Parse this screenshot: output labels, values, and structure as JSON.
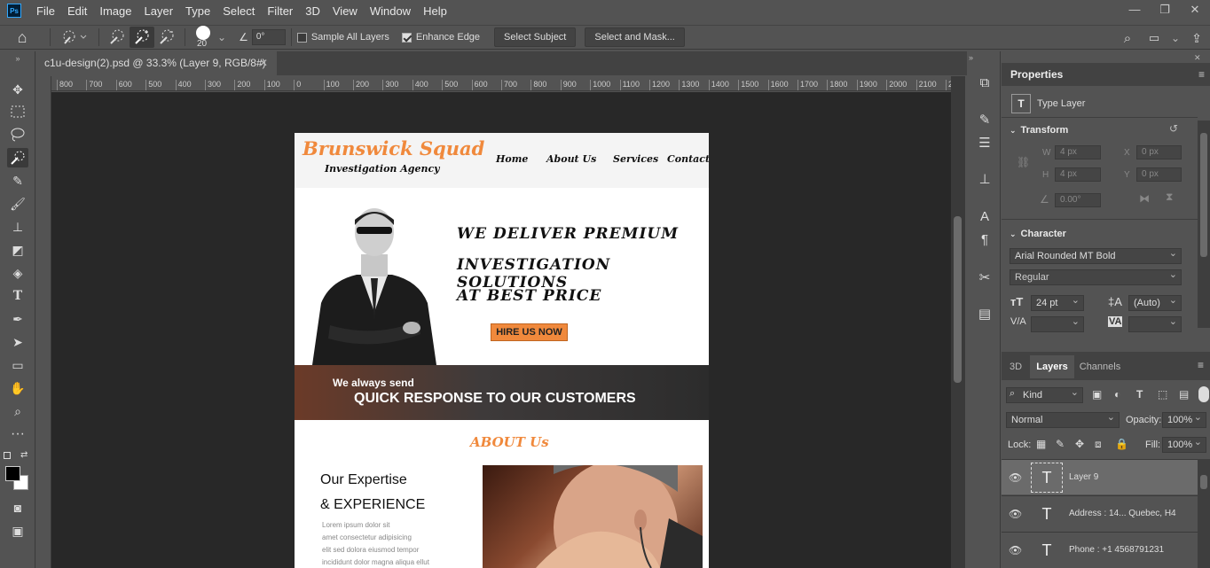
{
  "app": {
    "logo": "Ps"
  },
  "menu": [
    "File",
    "Edit",
    "Image",
    "Layer",
    "Type",
    "Select",
    "Filter",
    "3D",
    "View",
    "Window",
    "Help"
  ],
  "window_controls": {
    "minimize": "—",
    "restore": "❐",
    "close": "✕"
  },
  "options": {
    "brush_size": "20",
    "angle": "0°",
    "sample_all_layers": "Sample All Layers",
    "enhance_edge": "Enhance Edge",
    "select_subject": "Select Subject",
    "select_and_mask": "Select and Mask..."
  },
  "document": {
    "tab_title": "c1u-design(2).psd @ 33.3% (Layer 9, RGB/8#)"
  },
  "ruler": {
    "ticks": [
      "800",
      "700",
      "600",
      "500",
      "400",
      "300",
      "200",
      "100",
      "0",
      "100",
      "200",
      "300",
      "400",
      "500",
      "600",
      "700",
      "800",
      "900",
      "1000",
      "1100",
      "1200",
      "1300",
      "1400",
      "1500",
      "1600",
      "1700",
      "1800",
      "1900",
      "2000",
      "2100",
      "2"
    ]
  },
  "site": {
    "brand": "Brunswick Squad",
    "tagline": "Investigation Agency",
    "nav": [
      "Home",
      "About Us",
      "Services",
      "Contact"
    ],
    "hero_lines": [
      "WE DELIVER PREMIUM",
      "INVESTIGATION SOLUTIONS",
      "AT BEST PRICE"
    ],
    "hire_button": "HIRE US NOW",
    "band_small": "We always send",
    "band_large": "QUICK RESPONSE TO OUR CUSTOMERS",
    "about_heading": "ABOUT Us",
    "expertise_1": "Our Expertise",
    "expertise_2": "& EXPERIENCE",
    "lorem": [
      "Lorem ipsum dolor sit",
      "amet consectetur adipisicing",
      "elit sed dolora eiusmod tempor",
      "incididunt dolor magna aliqua ellut"
    ]
  },
  "properties": {
    "title": "Properties",
    "type_layer": "Type Layer",
    "transform": "Transform",
    "w_label": "W",
    "w_value": "4 px",
    "h_label": "H",
    "h_value": "4 px",
    "x_label": "X",
    "x_value": "0 px",
    "y_label": "Y",
    "y_value": "0 px",
    "angle_value": "0.00°",
    "character": "Character",
    "font_family": "Arial Rounded MT Bold",
    "font_style": "Regular",
    "font_size": "24 pt",
    "leading": "(Auto)",
    "va_label": "V/A",
    "va_label2": "VA"
  },
  "layers_panel": {
    "tabs": [
      "3D",
      "Layers",
      "Channels"
    ],
    "kind": "Kind",
    "blend_mode": "Normal",
    "opacity_label": "Opacity:",
    "opacity": "100%",
    "lock_label": "Lock:",
    "fill_label": "Fill:",
    "fill": "100%",
    "layers": [
      {
        "name": "Layer 9"
      },
      {
        "name": "Address : 14... Quebec, H4"
      },
      {
        "name": "Phone : +1 4568791231"
      }
    ]
  }
}
